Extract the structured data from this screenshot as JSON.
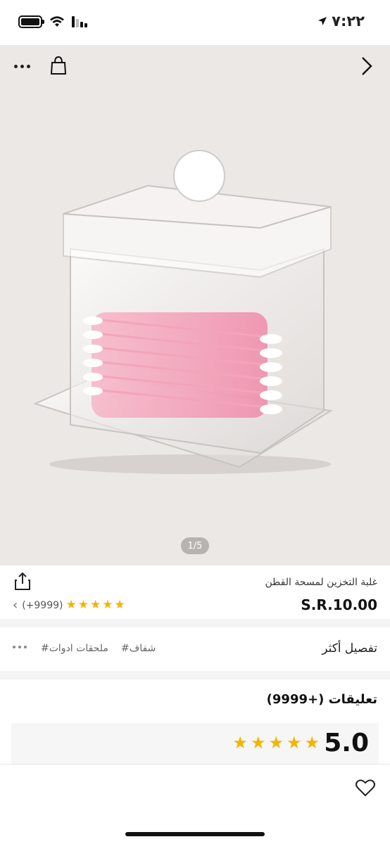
{
  "status_bar": {
    "time": "٧:٢٢"
  },
  "hero": {
    "pager": "1/5"
  },
  "product": {
    "title": "غلبة التخزين لمسحة القطن",
    "price": "S.R.10.00",
    "rating_count": "(+9999)",
    "stars": 5,
    "star_color": "#f5b400"
  },
  "tags": {
    "title": "تفصيل أكثر",
    "items": [
      "#شفاف",
      "#ملحقات ادوات"
    ]
  },
  "reviews": {
    "title": "تعليقات (+9999)",
    "score": "5.0"
  },
  "icons": {
    "more": "more-icon",
    "bag": "shopping-bag-icon",
    "back": "chevron-right-icon",
    "share": "share-icon",
    "heart": "heart-icon"
  }
}
